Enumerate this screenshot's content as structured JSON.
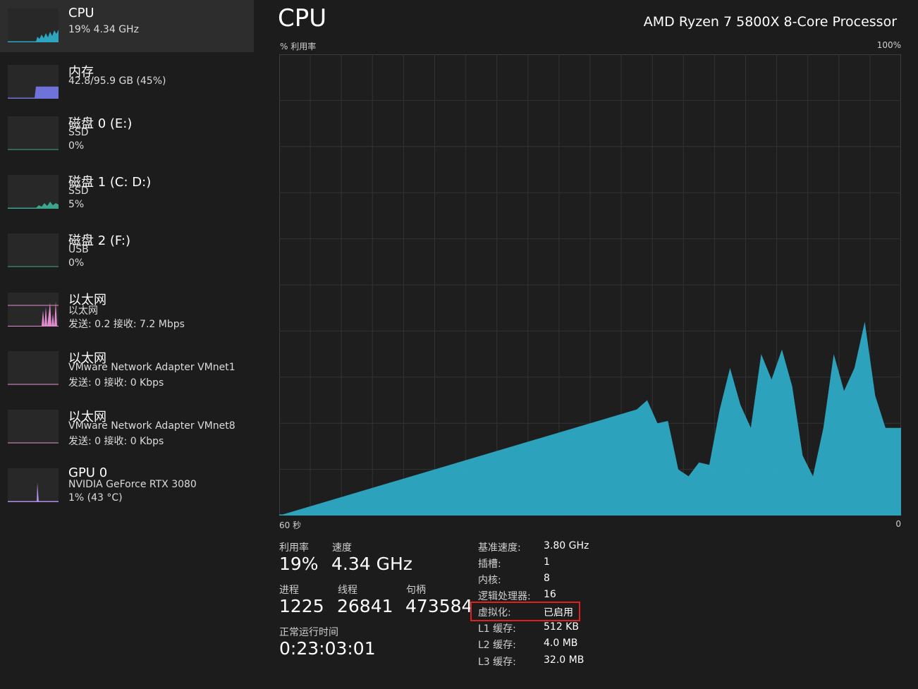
{
  "colors": {
    "cpu": "#2ea5c0",
    "memory": "#6f73d9",
    "disk": "#3aa58c",
    "ethernet": "#e58bd0",
    "gpu": "#b38ae6",
    "highlight": "#e02020"
  },
  "sidebar": {
    "items": [
      {
        "title": "CPU",
        "lines": [
          "19% 4.34 GHz"
        ]
      },
      {
        "title": "内存",
        "lines": [
          "42.8/95.9 GB (45%)"
        ]
      },
      {
        "title": "磁盘 0 (E:)",
        "lines": [
          "SSD",
          "0%"
        ]
      },
      {
        "title": "磁盘 1 (C: D:)",
        "lines": [
          "SSD",
          "5%"
        ]
      },
      {
        "title": "磁盘 2 (F:)",
        "lines": [
          "USB",
          "0%"
        ]
      },
      {
        "title": "以太网",
        "lines": [
          "以太网",
          "发送: 0.2 接收: 7.2 Mbps"
        ]
      },
      {
        "title": "以太网",
        "lines": [
          "VMware Network Adapter VMnet1",
          "发送: 0 接收: 0 Kbps"
        ]
      },
      {
        "title": "以太网",
        "lines": [
          "VMware Network Adapter VMnet8",
          "发送: 0 接收: 0 Kbps"
        ]
      },
      {
        "title": "GPU 0",
        "lines": [
          "NVIDIA GeForce RTX 3080",
          "1% (43 °C)"
        ]
      }
    ],
    "memory_used_fraction": 0.45
  },
  "main": {
    "title": "CPU",
    "processor": "AMD Ryzen 7 5800X 8-Core Processor",
    "graph": {
      "y_label": "% 利用率",
      "y_max_label": "100%",
      "x_left_label": "60 秒",
      "x_right_label": "0"
    },
    "stats": {
      "utilization_label": "利用率",
      "utilization": "19%",
      "speed_label": "速度",
      "speed": "4.34 GHz",
      "processes_label": "进程",
      "processes": "1225",
      "threads_label": "线程",
      "threads": "26841",
      "handles_label": "句柄",
      "handles": "473584",
      "uptime_label": "正常运行时间",
      "uptime": "0:23:03:01"
    },
    "specs": [
      {
        "key": "基准速度:",
        "value": "3.80 GHz"
      },
      {
        "key": "插槽:",
        "value": "1"
      },
      {
        "key": "内核:",
        "value": "8"
      },
      {
        "key": "逻辑处理器:",
        "value": "16"
      },
      {
        "key": "虚拟化:",
        "value": "已启用"
      },
      {
        "key": "L1 缓存:",
        "value": "512 KB"
      },
      {
        "key": "L2 缓存:",
        "value": "4.0 MB"
      },
      {
        "key": "L3 缓存:",
        "value": "32.0 MB"
      }
    ]
  },
  "chart_data": {
    "type": "area",
    "x_range": [
      60,
      0
    ],
    "ylim": [
      0,
      100
    ],
    "grid": true,
    "x": [
      60,
      25.5,
      24.5,
      23.5,
      22.5,
      21.5,
      20.5,
      19.5,
      18.5,
      17.5,
      16.5,
      15.5,
      14.5,
      13.5,
      12.5,
      11.5,
      10.5,
      9.5,
      8.5,
      7.5,
      6.5,
      5.5,
      4.5,
      3.5,
      2.5,
      1.5,
      0.5,
      0
    ],
    "values": [
      0,
      23,
      25,
      20,
      20.5,
      10,
      8.5,
      11.5,
      11,
      23,
      32,
      24,
      19,
      35,
      29.5,
      36,
      28,
      13,
      8.5,
      19,
      35,
      27,
      32,
      42,
      26,
      19,
      19,
      19
    ]
  }
}
